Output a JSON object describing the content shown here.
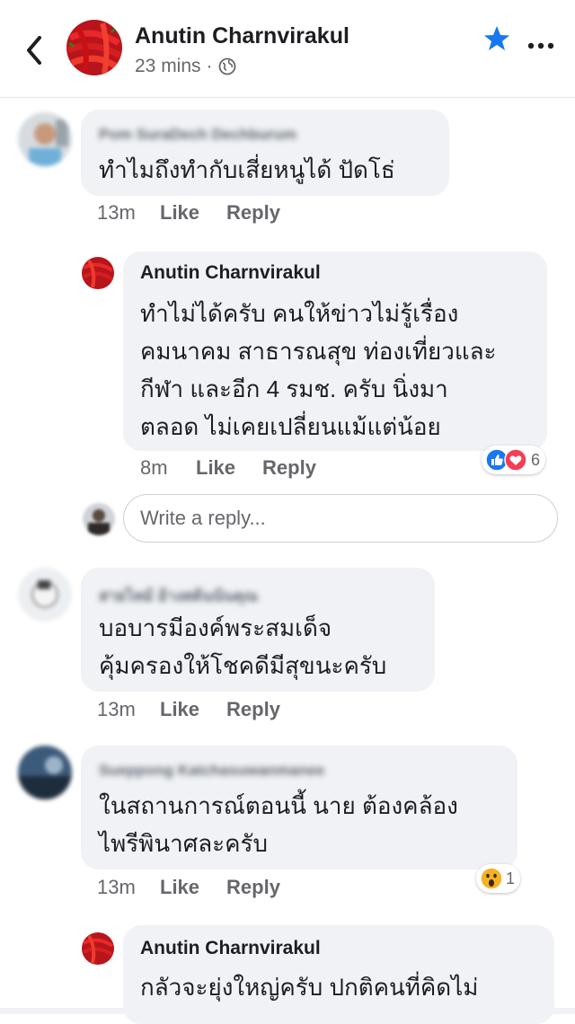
{
  "header": {
    "page_name": "Anutin Charnvirakul",
    "time": "23 mins",
    "separator": "·"
  },
  "comments": [
    {
      "name": "Pom SuraDech Dechburum",
      "lines": [
        "ทำไมถึงทำกับเสี่ยหนูได้ ปัดโธ่"
      ],
      "time": "13m",
      "like": "Like",
      "reply": "Reply"
    },
    {
      "name": "Anutin Charnvirakul",
      "lines": [
        "ทำไม่ได้ครับ คนให้ข่าวไม่รู้เรื่อง",
        "คมนาคม สาธารณสุข ท่องเที่ยวและ",
        "กีฬา และอีก 4 รมช. ครับ นิ่งมา",
        "ตลอด ไม่เคยเปลี่ยนแม้แต่น้อย"
      ],
      "time": "8m",
      "like": "Like",
      "reply": "Reply",
      "reaction_count": "6"
    },
    {
      "name": "สายไหม้ อ้างสด้นน้นคุณ",
      "lines": [
        "บอบารมีองค์พระสมเด็จ",
        "คุ้มครองให้โชคดีมีสุขนะครับ"
      ],
      "time": "13m",
      "like": "Like",
      "reply": "Reply"
    },
    {
      "name": "Sueppong Katchasuwanmanee",
      "lines": [
        "ในสถานการณ์ตอนนี้ นาย ต้องคล้อง",
        "ไพรีพินาศละครับ"
      ],
      "time": "13m",
      "like": "Like",
      "reply": "Reply",
      "reaction_count": "1"
    },
    {
      "name": "Anutin Charnvirakul",
      "lines": [
        "กลัวจะยุ่งใหญ่ครับ ปกติคนที่คิดไม่"
      ]
    }
  ],
  "reply_input": {
    "placeholder": "Write a reply..."
  },
  "icons": {
    "back": "chevron-left-icon",
    "globe": "globe-icon",
    "star": "star-icon",
    "more": "more-dots-icon",
    "like_reaction": "like-reaction-icon",
    "love_reaction": "love-reaction-icon",
    "wow_reaction": "wow-reaction-icon"
  },
  "colors": {
    "accent_blue": "#1877f2",
    "love_red": "#f33e58",
    "wow_yellow": "#f7b125",
    "bubble_gray": "#f0f2f5",
    "secondary_text": "#65676b"
  }
}
